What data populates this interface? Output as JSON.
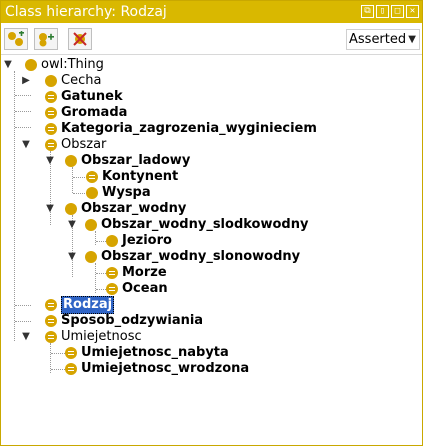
{
  "window": {
    "title": "Class hierarchy: Rodzaj",
    "controls": [
      "⧉",
      "▯",
      "□",
      "✕"
    ]
  },
  "toolbar": {
    "buttons": [
      {
        "name": "add-subclass-button",
        "icon": "add-subclass-icon"
      },
      {
        "name": "add-sibling-button",
        "icon": "add-sibling-icon"
      },
      {
        "name": "delete-class-button",
        "icon": "delete-class-icon"
      }
    ],
    "mode": "Asserted"
  },
  "tree": {
    "rows": [
      {
        "label": "owl:Thing",
        "bold": false,
        "eq": false,
        "toggle": "▼"
      },
      {
        "label": "Cecha",
        "bold": false,
        "eq": false,
        "toggle": "▶"
      },
      {
        "label": "Gatunek",
        "bold": true,
        "eq": true,
        "toggle": ""
      },
      {
        "label": "Gromada",
        "bold": true,
        "eq": true,
        "toggle": ""
      },
      {
        "label": "Kategoria_zagrozenia_wyginieciem",
        "bold": true,
        "eq": true,
        "toggle": ""
      },
      {
        "label": "Obszar",
        "bold": false,
        "eq": true,
        "toggle": "▼"
      },
      {
        "label": "Obszar_ladowy",
        "bold": true,
        "eq": false,
        "toggle": "▼"
      },
      {
        "label": "Kontynent",
        "bold": true,
        "eq": true,
        "toggle": ""
      },
      {
        "label": "Wyspa",
        "bold": true,
        "eq": false,
        "toggle": ""
      },
      {
        "label": "Obszar_wodny",
        "bold": true,
        "eq": false,
        "toggle": "▼"
      },
      {
        "label": "Obszar_wodny_slodkowodny",
        "bold": true,
        "eq": false,
        "toggle": "▼"
      },
      {
        "label": "Jezioro",
        "bold": true,
        "eq": false,
        "toggle": ""
      },
      {
        "label": "Obszar_wodny_slonowodny",
        "bold": true,
        "eq": false,
        "toggle": "▼"
      },
      {
        "label": "Morze",
        "bold": true,
        "eq": true,
        "toggle": ""
      },
      {
        "label": "Ocean",
        "bold": true,
        "eq": true,
        "toggle": ""
      },
      {
        "label": "Rodzaj",
        "bold": true,
        "eq": true,
        "toggle": "",
        "selected": true
      },
      {
        "label": "Sposob_odzywiania",
        "bold": true,
        "eq": true,
        "toggle": ""
      },
      {
        "label": "Umiejetnosc",
        "bold": false,
        "eq": true,
        "toggle": "▼"
      },
      {
        "label": "Umiejetnosc_nabyta",
        "bold": true,
        "eq": true,
        "toggle": ""
      },
      {
        "label": "Umiejetnosc_wrodzona",
        "bold": true,
        "eq": true,
        "toggle": ""
      }
    ]
  }
}
